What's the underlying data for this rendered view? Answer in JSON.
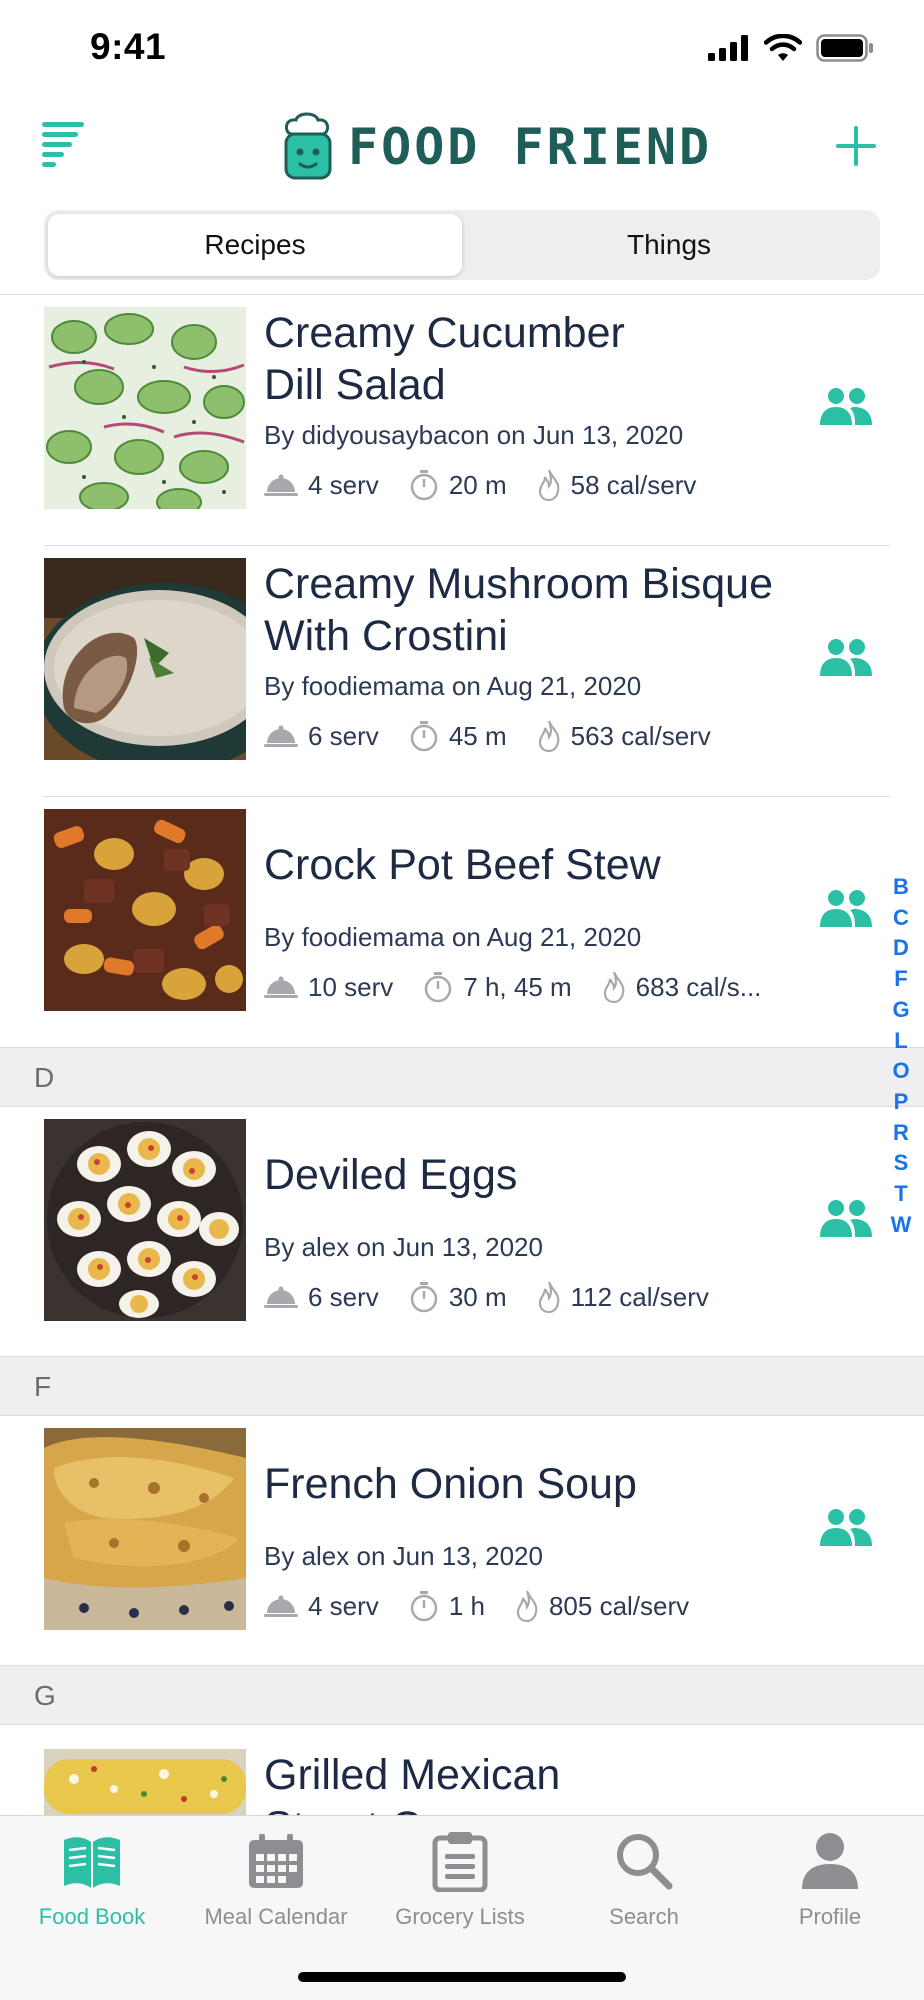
{
  "status": {
    "time": "9:41"
  },
  "header": {
    "brand_title": "FOOD FRIEND"
  },
  "segments": [
    {
      "label": "Recipes",
      "active": true
    },
    {
      "label": "Things",
      "active": false
    }
  ],
  "recipes": [
    {
      "title": "Creamy Cucumber Dill Salad",
      "byline": "By didyousaybacon on Jun 13, 2020",
      "servings": "4 serv",
      "time": "20 m",
      "calories": "58 cal/serv"
    },
    {
      "title": "Creamy Mushroom Bisque With Crostini",
      "byline": "By foodiemama on Aug 21, 2020",
      "servings": "6 serv",
      "time": "45 m",
      "calories": "563 cal/serv"
    },
    {
      "title": "Crock Pot Beef Stew",
      "byline": "By foodiemama on Aug 21, 2020",
      "servings": "10 serv",
      "time": "7 h, 45 m",
      "calories": "683 cal/s..."
    },
    {
      "section": "D"
    },
    {
      "title": "Deviled Eggs",
      "byline": "By alex on Jun 13, 2020",
      "servings": "6 serv",
      "time": "30 m",
      "calories": "112 cal/serv"
    },
    {
      "section": "F"
    },
    {
      "title": "French Onion Soup",
      "byline": "By alex on Jun 13, 2020",
      "servings": "4 serv",
      "time": "1 h",
      "calories": "805 cal/serv"
    },
    {
      "section": "G"
    },
    {
      "title": "Grilled Mexican Street Corn",
      "byline": "",
      "servings": "",
      "time": "",
      "calories": ""
    }
  ],
  "section_index": [
    "B",
    "C",
    "D",
    "F",
    "G",
    "L",
    "O",
    "P",
    "R",
    "S",
    "T",
    "W"
  ],
  "tabs": [
    {
      "label": "Food Book",
      "icon": "book-icon",
      "active": true
    },
    {
      "label": "Meal Calendar",
      "icon": "calendar-icon",
      "active": false
    },
    {
      "label": "Grocery Lists",
      "icon": "clipboard-icon",
      "active": false
    },
    {
      "label": "Search",
      "icon": "search-icon",
      "active": false
    },
    {
      "label": "Profile",
      "icon": "person-icon",
      "active": false
    }
  ],
  "colors": {
    "accent": "#2bbfa6",
    "brand_text": "#1e5d58",
    "index_blue": "#1a73e8",
    "title_navy": "#1d2a44"
  }
}
